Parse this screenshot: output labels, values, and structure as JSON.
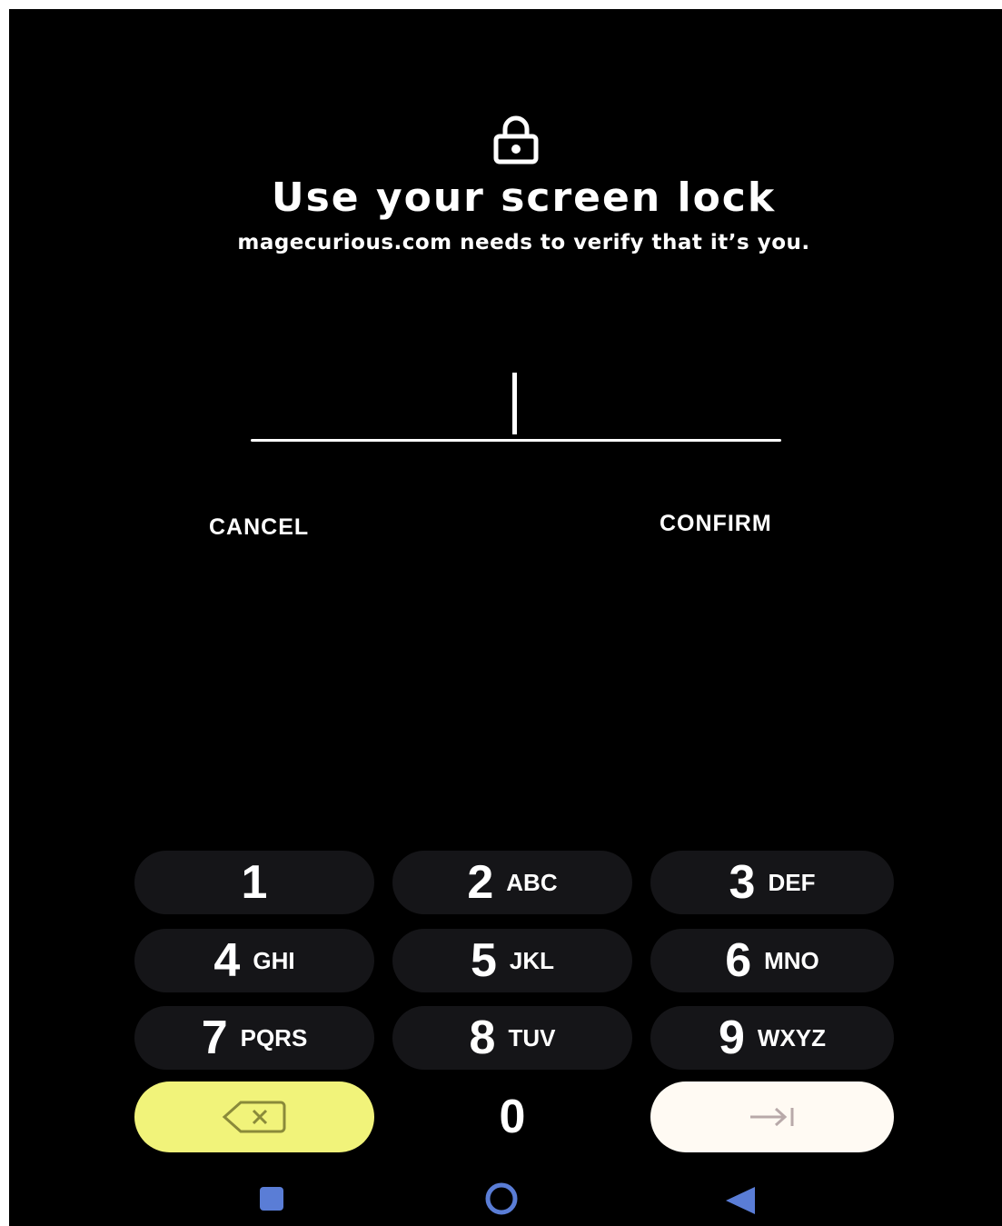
{
  "header": {
    "icon": "lock-icon",
    "title": "Use your screen lock",
    "subtitle": "magecurious.com needs to verify that it’s you."
  },
  "pin": {
    "value": ""
  },
  "actions": {
    "cancel": "CANCEL",
    "confirm": "CONFIRM"
  },
  "keypad": {
    "keys": [
      {
        "digit": "1",
        "letters": ""
      },
      {
        "digit": "2",
        "letters": "ABC"
      },
      {
        "digit": "3",
        "letters": "DEF"
      },
      {
        "digit": "4",
        "letters": "GHI"
      },
      {
        "digit": "5",
        "letters": "JKL"
      },
      {
        "digit": "6",
        "letters": "MNO"
      },
      {
        "digit": "7",
        "letters": "PQRS"
      },
      {
        "digit": "8",
        "letters": "TUV"
      },
      {
        "digit": "9",
        "letters": "WXYZ"
      },
      {
        "digit": "0",
        "letters": ""
      }
    ],
    "backspace_icon": "backspace-icon",
    "enter_icon": "enter-arrow-icon"
  },
  "navbar": {
    "icons": [
      "recents-icon",
      "home-icon",
      "back-icon"
    ]
  },
  "colors": {
    "background": "#000000",
    "backspace": "#f1f37a",
    "enter": "#fffaf3",
    "nav_accent": "#5a7dd6"
  }
}
